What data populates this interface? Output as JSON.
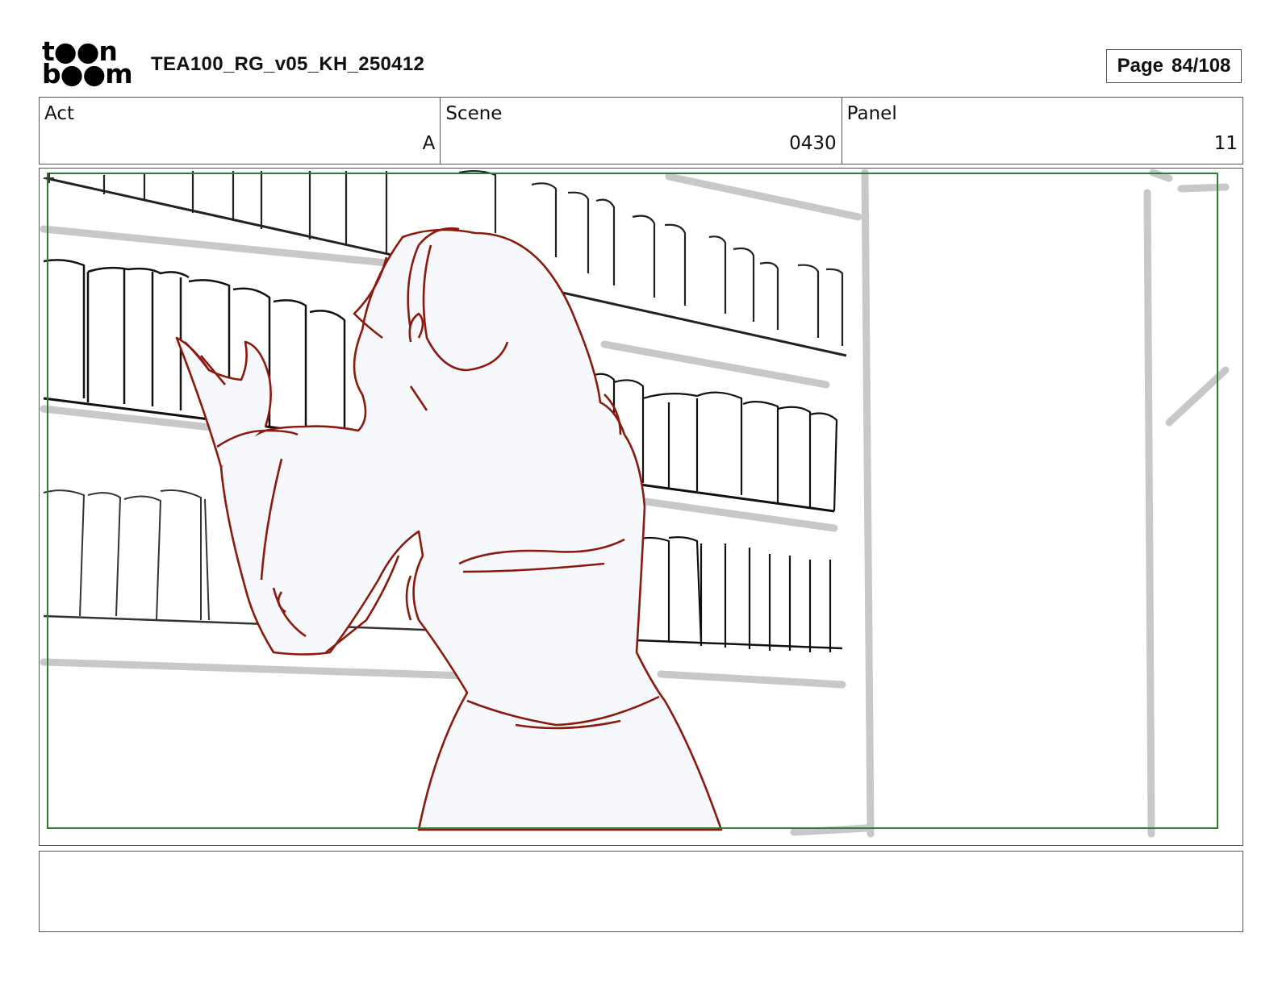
{
  "header": {
    "logo_text": "toon boom",
    "logo_line1": "t●●n",
    "logo_line2": "b●●m",
    "title": "TEA100_RG_v05_KH_250412",
    "page_label": "Page",
    "page_value": "84/108"
  },
  "info": {
    "act_label": "Act",
    "act_value": "A",
    "scene_label": "Scene",
    "scene_value": "0430",
    "panel_label": "Panel",
    "panel_value": "11"
  },
  "panel": {
    "safe_frame_color": "#2e7d32",
    "character_line_color": "#8b1a0e",
    "character_fill_color": "#f6f8fb",
    "bookshelf_line_color": "#222222",
    "shelf_shadow_color": "#c8c8c8"
  },
  "caption": {
    "text": ""
  }
}
